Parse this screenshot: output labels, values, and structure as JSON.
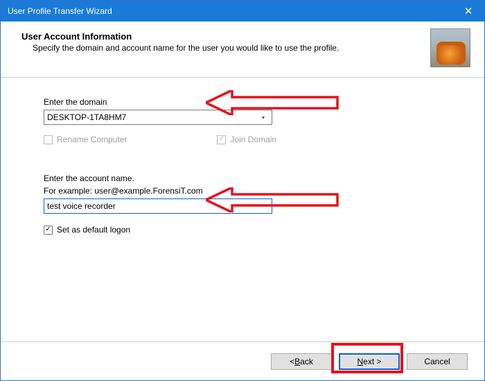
{
  "window": {
    "title": "User Profile Transfer Wizard",
    "close_glyph": "✕"
  },
  "header": {
    "title": "User Account Information",
    "subtitle": "Specify the domain and account name for the user you would like to use the profile."
  },
  "domain": {
    "label": "Enter the domain",
    "value": "DESKTOP-1TA8HM7",
    "rename_label": "Rename Computer",
    "rename_checked": false,
    "rename_enabled": false,
    "join_label": "Join Domain",
    "join_checked": true,
    "join_enabled": false
  },
  "account": {
    "label_line1": "Enter the account name.",
    "label_line2": "For example: user@example.ForensiT.com",
    "value": "test voice recorder",
    "default_logon_label": "Set as default logon",
    "default_logon_checked": true
  },
  "buttons": {
    "back_prefix": "< ",
    "back_char": "B",
    "back_rest": "ack",
    "next_char": "N",
    "next_rest": "ext >",
    "cancel": "Cancel"
  },
  "glyphs": {
    "check": "✓",
    "dropdown": "▾"
  }
}
